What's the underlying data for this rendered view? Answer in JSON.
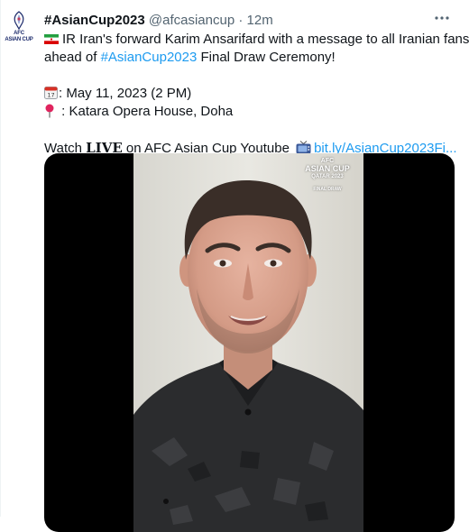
{
  "tweet": {
    "account_name": "#AsianCup2023",
    "handle": "@afcasiancup",
    "separator": "·",
    "time": "12m",
    "avatar": {
      "line1": "AFC",
      "line2": "ASIAN CUP"
    },
    "more_icon": "more-horizontal-icon",
    "text": {
      "line1": "IR Iran's forward Karim Ansarifard with a message to all Iranian fans",
      "line2_prefix": "ahead of ",
      "line2_hashtag": "#AsianCup2023",
      "line2_suffix": " Final Draw Ceremony!",
      "date": ": May 11, 2023 (2 PM)",
      "location": " : Katara Opera House, Doha",
      "watch_prefix": "Watch ",
      "watch_live": "LIVE",
      "watch_suffix": " on AFC Asian Cup Youtube",
      "link": "bit.ly/AsianCup2023Fi..."
    },
    "icons": {
      "flag": "iran-flag-icon",
      "calendar": "calendar-icon",
      "pin": "round-pushpin-icon",
      "tv": "television-icon"
    },
    "media": {
      "overlay_logo": {
        "line1": "AFC",
        "line2": "ASIAN CUP",
        "line3": "QATAR 2023",
        "line4": "FINAL DRAW"
      }
    }
  },
  "colors": {
    "link": "#1d9bf0",
    "secondary_text": "#536471",
    "primary_text": "#0f1419"
  }
}
